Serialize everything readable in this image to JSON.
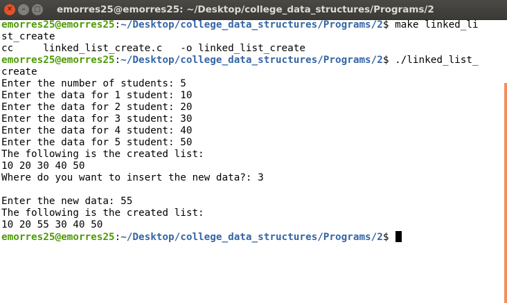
{
  "window": {
    "title": "emorres25@emorres25: ~/Desktop/college_data_structures/Programs/2",
    "close_glyph": "✕",
    "minimize_glyph": "–",
    "maximize_glyph": "□"
  },
  "colors": {
    "user_host": "#4e9a06",
    "path": "#3465a4",
    "text": "#000000",
    "scrollbar": "#f08f5e"
  },
  "prompt": {
    "user_host": "emorres25@emorres25",
    "separator": ":",
    "path": "~/Desktop/college_data_structures/Programs/2",
    "symbol": "$ "
  },
  "session": {
    "cmd1_a": "make linked_li",
    "cmd1_b": "st_create",
    "compile_line": "cc     linked_list_create.c   -o linked_list_create",
    "cmd2_a": "./linked_list_",
    "cmd2_b": "create",
    "output": [
      "Enter the number of students: 5",
      "Enter the data for 1 student: 10",
      "Enter the data for 2 student: 20",
      "Enter the data for 3 student: 30",
      "Enter the data for 4 student: 40",
      "Enter the data for 5 student: 50",
      "The following is the created list:",
      "10 20 30 40 50",
      "Where do you want to insert the new data?: 3",
      "",
      "Enter the new data: 55",
      "The following is the created list:",
      "10 20 55 30 40 50"
    ]
  }
}
